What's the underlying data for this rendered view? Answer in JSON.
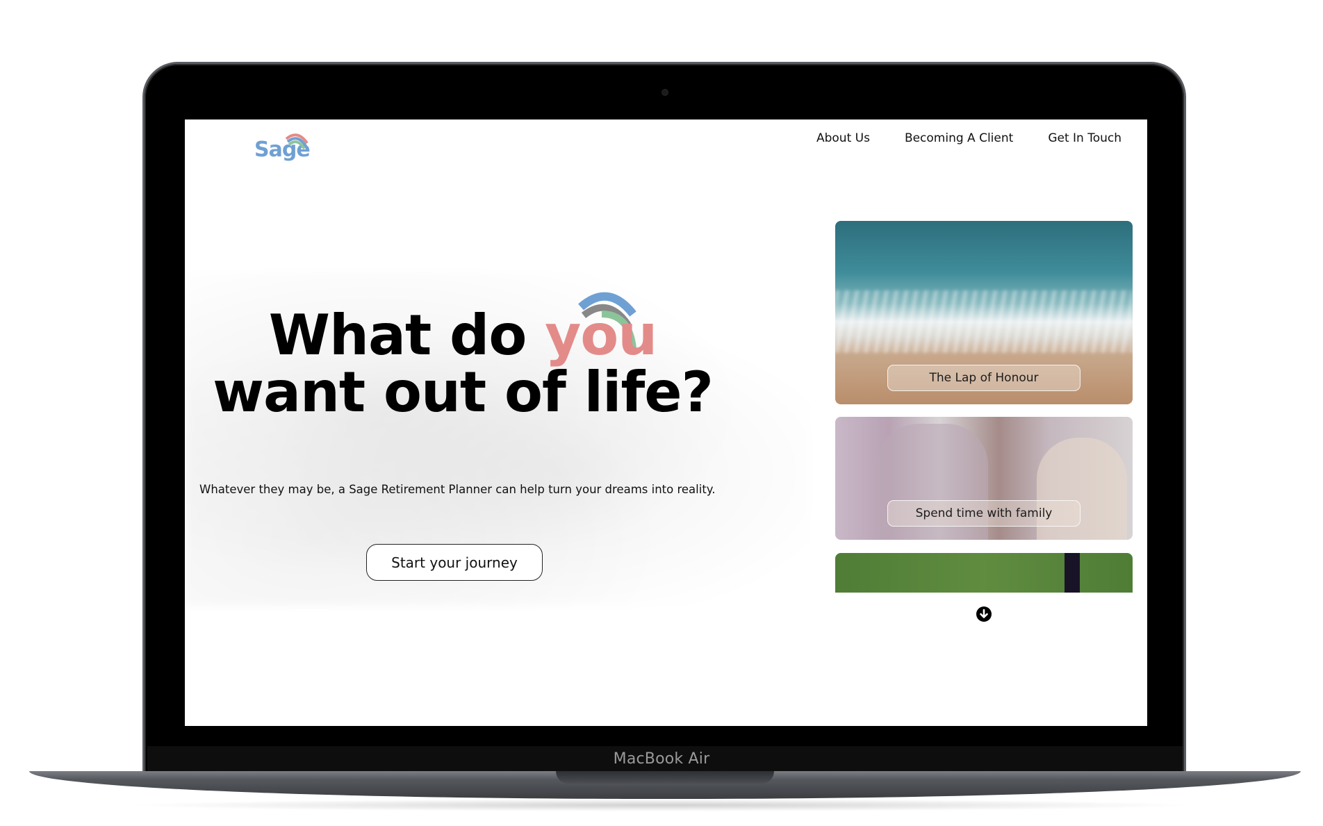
{
  "device": {
    "label": "MacBook Air"
  },
  "site": {
    "logo_text": "Sage",
    "nav": [
      {
        "label": "About Us"
      },
      {
        "label": "Becoming A Client"
      },
      {
        "label": "Get In Touch"
      }
    ]
  },
  "hero": {
    "headline_part1": "What do",
    "headline_accent": "you",
    "headline_part2": "want out of life?",
    "subtext": "Whatever they may be, a Sage Retirement Planner can help turn your dreams into reality.",
    "cta_label": "Start your journey"
  },
  "cards": [
    {
      "label": "The Lap of Honour",
      "icon": "beach-image"
    },
    {
      "label": "Spend time with family",
      "icon": "family-image"
    },
    {
      "label": "",
      "icon": "golf-image"
    }
  ],
  "icons": {
    "scroll": "arrow-down-circle-icon"
  },
  "colors": {
    "accent": "#e38b89",
    "logo_blue": "#6fa0d4",
    "logo_green": "#8cc49a"
  }
}
